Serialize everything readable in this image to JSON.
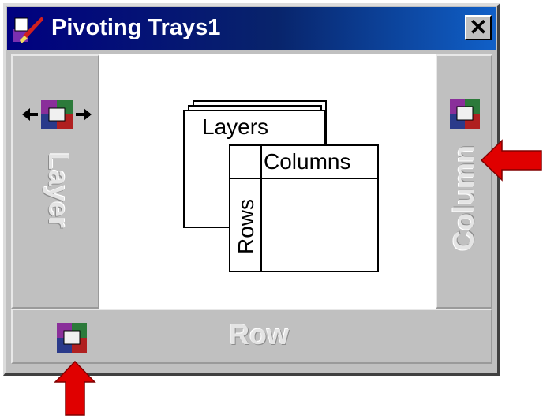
{
  "window": {
    "title": "Pivoting Trays1",
    "close_label": "✕"
  },
  "trays": {
    "layer_label": "Layer",
    "column_label": "Column",
    "row_label": "Row"
  },
  "diagram": {
    "layers_label": "Layers",
    "columns_label": "Columns",
    "rows_label": "Rows"
  },
  "colors": {
    "titlebar": "#0a246a",
    "tray": "#c0c0c0",
    "arrow": "#e00000"
  },
  "icons": [
    "pivot-app-icon",
    "close-icon",
    "pivot-icon-movable",
    "pivot-icon",
    "red-arrow"
  ]
}
